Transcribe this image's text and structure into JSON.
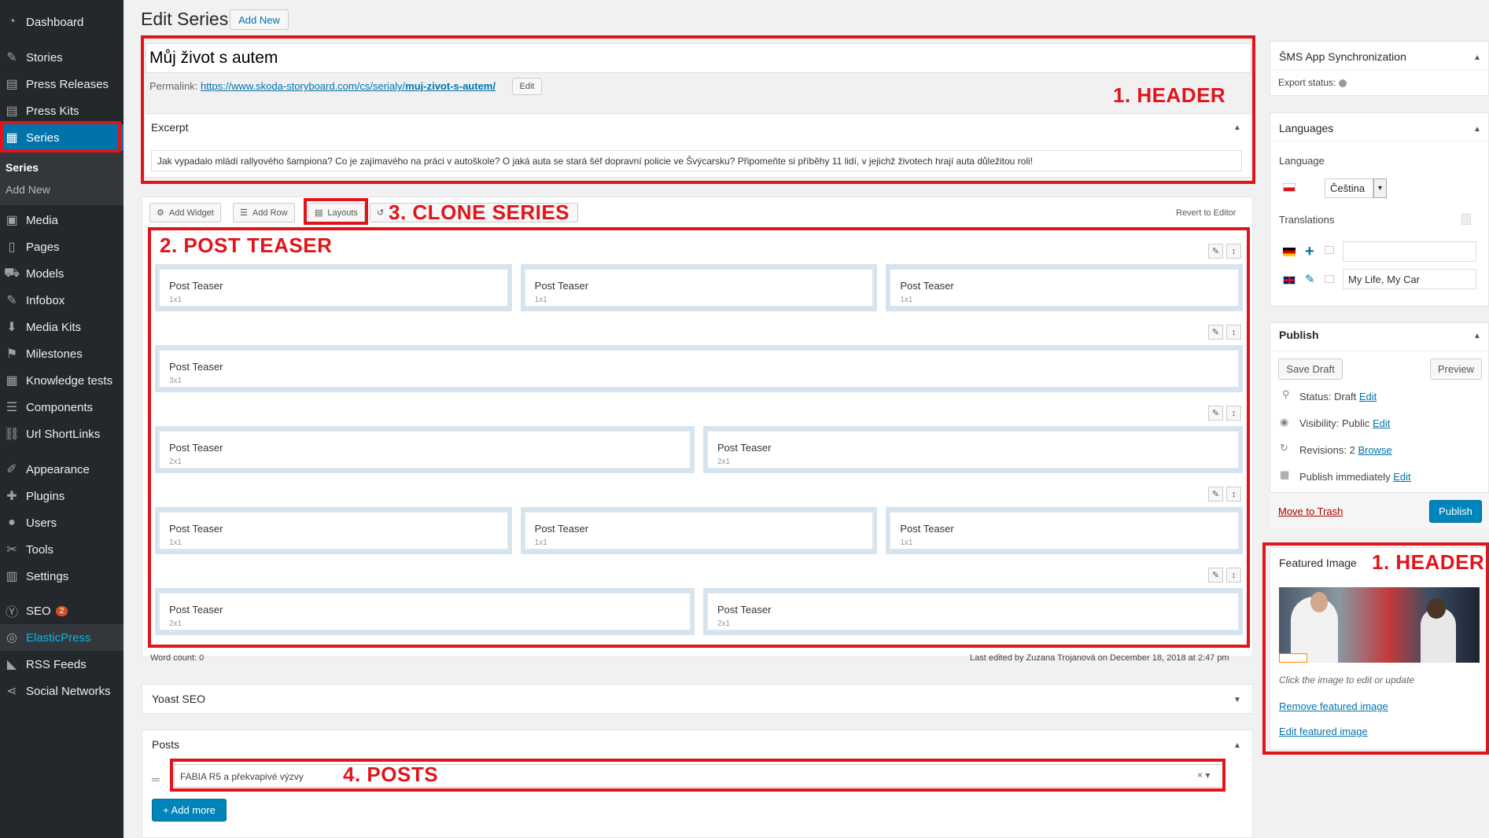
{
  "sidebar": {
    "items": [
      {
        "label": "Dashboard",
        "icon": "dashboard-icon",
        "glyph": "◔"
      },
      {
        "label": "Stories",
        "icon": "pin-icon",
        "glyph": "✎"
      },
      {
        "label": "Press Releases",
        "icon": "list-icon",
        "glyph": "▤"
      },
      {
        "label": "Press Kits",
        "icon": "kit-icon",
        "glyph": "▤"
      },
      {
        "label": "Series",
        "icon": "grid-icon",
        "glyph": "▦"
      },
      {
        "label": "Media",
        "icon": "media-icon",
        "glyph": "▣"
      },
      {
        "label": "Pages",
        "icon": "pages-icon",
        "glyph": "▯"
      },
      {
        "label": "Models",
        "icon": "car-icon",
        "glyph": "⛟"
      },
      {
        "label": "Infobox",
        "icon": "infobox-icon",
        "glyph": "✎"
      },
      {
        "label": "Media Kits",
        "icon": "download-icon",
        "glyph": "⬇"
      },
      {
        "label": "Milestones",
        "icon": "flag-icon",
        "glyph": "⚑"
      },
      {
        "label": "Knowledge tests",
        "icon": "tests-icon",
        "glyph": "▦"
      },
      {
        "label": "Components",
        "icon": "components-icon",
        "glyph": "☰"
      },
      {
        "label": "Url ShortLinks",
        "icon": "link-icon",
        "glyph": "⛓"
      },
      {
        "label": "Appearance",
        "icon": "appearance-icon",
        "glyph": "✐"
      },
      {
        "label": "Plugins",
        "icon": "plugins-icon",
        "glyph": "✚"
      },
      {
        "label": "Users",
        "icon": "users-icon",
        "glyph": "●"
      },
      {
        "label": "Tools",
        "icon": "tools-icon",
        "glyph": "✂"
      },
      {
        "label": "Settings",
        "icon": "settings-icon",
        "glyph": "▥"
      },
      {
        "label": "SEO",
        "icon": "seo-icon",
        "glyph": "Ⓨ",
        "badge": "2"
      },
      {
        "label": "ElasticPress",
        "icon": "elasticpress-icon",
        "glyph": "◎"
      },
      {
        "label": "RSS Feeds",
        "icon": "rss-icon",
        "glyph": "◣"
      },
      {
        "label": "Social Networks",
        "icon": "share-icon",
        "glyph": "⋖"
      }
    ],
    "submenu": {
      "current": "Series",
      "add_new": "Add New"
    }
  },
  "header": {
    "title": "Edit Series",
    "add_new": "Add New"
  },
  "post": {
    "title": "Můj život s autem",
    "permalink_label": "Permalink:",
    "permalink_base": "https://www.skoda-storyboard.com/cs/serialy/",
    "permalink_slug": "muj-zivot-s-autem/",
    "permalink_edit": "Edit"
  },
  "excerpt": {
    "heading": "Excerpt",
    "text": "Jak vypadalo mládí rallyového šampiona? Co je zajímavého na práci v autoškole? O jaká auta se stará šéf dopravní policie ve Švýcarsku? Připomeňte si příběhy 11 lidí, v jejichž životech hrají auta důležitou roli!"
  },
  "page_builder": {
    "tools": {
      "add_widget": "Add Widget",
      "add_row": "Add Row",
      "layouts": "Layouts"
    },
    "revert": "Revert to Editor",
    "rows": [
      [
        {
          "title": "Post Teaser",
          "size": "1x1"
        },
        {
          "title": "Post Teaser",
          "size": "1x1"
        },
        {
          "title": "Post Teaser",
          "size": "1x1"
        }
      ],
      [
        {
          "title": "Post Teaser",
          "size": "3x1"
        }
      ],
      [
        {
          "title": "Post Teaser",
          "size": "2x1"
        },
        {
          "title": "Post Teaser",
          "size": "2x1"
        }
      ],
      [
        {
          "title": "Post Teaser",
          "size": "1x1"
        },
        {
          "title": "Post Teaser",
          "size": "1x1"
        },
        {
          "title": "Post Teaser",
          "size": "1x1"
        }
      ],
      [
        {
          "title": "Post Teaser",
          "size": "2x1"
        },
        {
          "title": "Post Teaser",
          "size": "2x1"
        }
      ]
    ],
    "word_count": "Word count: 0",
    "last_edited": "Last edited by Zuzana Trojanová on December 18, 2018 at 2:47 pm"
  },
  "yoast": {
    "heading": "Yoast SEO"
  },
  "posts": {
    "heading": "Posts",
    "selected": "FABIA R5 a překvapivé výzvy",
    "add_more": "+ Add more"
  },
  "annotations": {
    "header": "1. HEADER",
    "post_teaser": "2. POST TEASER",
    "clone_series": "3. CLONE SERIES",
    "posts": "4. POSTS",
    "header_featured": "1. HEADER"
  },
  "sms": {
    "heading": "ŠMS App Synchronization",
    "export_label": "Export status:"
  },
  "languages": {
    "heading": "Languages",
    "language_label": "Language",
    "selected": "Čeština",
    "translations_label": "Translations",
    "translations": [
      {
        "flag": "de",
        "value": ""
      },
      {
        "flag": "gb",
        "value": "My Life, My Car"
      }
    ]
  },
  "publish": {
    "heading": "Publish",
    "save_draft": "Save Draft",
    "preview": "Preview",
    "status_label": "Status: Draft",
    "visibility_label": "Visibility: Public",
    "revisions_label": "Revisions: 2",
    "publish_label": "Publish immediately",
    "edit": "Edit",
    "browse": "Browse",
    "trash": "Move to Trash",
    "publish_btn": "Publish"
  },
  "featured": {
    "heading": "Featured Image",
    "hint": "Click the image to edit or update",
    "remove": "Remove featured image",
    "edit": "Edit featured image"
  },
  "colors": {
    "accent": "#0073aa",
    "annotation": "#e0151b",
    "sidebar": "#23282d"
  }
}
